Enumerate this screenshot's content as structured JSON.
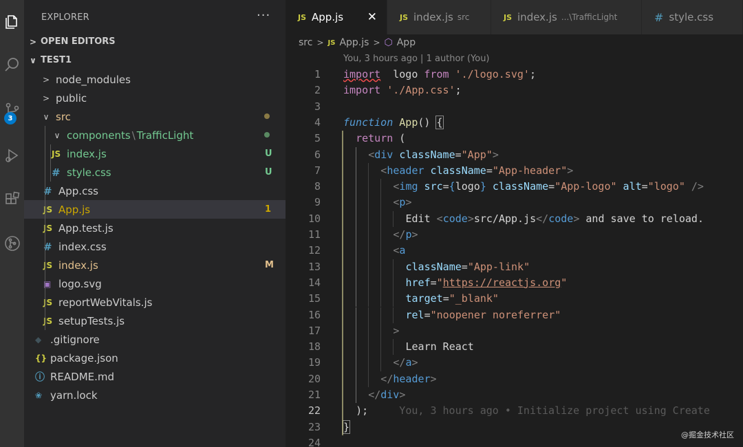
{
  "sidebar": {
    "title": "EXPLORER",
    "more": "···",
    "sections": [
      {
        "label": "OPEN EDITORS",
        "chev": ">"
      },
      {
        "label": "TEST1",
        "chev": "∨"
      }
    ],
    "badge": "3",
    "tree": [
      {
        "label": "node_modules",
        "type": "folder",
        "chev": ">",
        "depth": 1
      },
      {
        "label": "public",
        "type": "folder",
        "chev": ">",
        "depth": 1
      },
      {
        "label": "src",
        "type": "folder-open",
        "chev": "∨",
        "depth": 1,
        "status": "dot"
      },
      {
        "label": "components",
        "sub": "\\",
        "label2": "TrafficLight",
        "type": "folder-open",
        "chev": "∨",
        "depth": 2,
        "status": "dot-green"
      },
      {
        "label": "index.js",
        "type": "js",
        "icon": "JS",
        "depth": 3,
        "status": "U"
      },
      {
        "label": "style.css",
        "type": "css",
        "icon": "#",
        "depth": 3,
        "status": "U"
      },
      {
        "label": "App.css",
        "type": "css",
        "icon": "#",
        "depth": 2
      },
      {
        "label": "App.js",
        "type": "js",
        "icon": "JS",
        "depth": 2,
        "status": "1",
        "active": true
      },
      {
        "label": "App.test.js",
        "type": "js",
        "icon": "JS",
        "depth": 2
      },
      {
        "label": "index.css",
        "type": "css",
        "icon": "#",
        "depth": 2
      },
      {
        "label": "index.js",
        "type": "js",
        "icon": "JS",
        "depth": 2,
        "status": "M"
      },
      {
        "label": "logo.svg",
        "type": "svg",
        "icon": "▣",
        "depth": 2
      },
      {
        "label": "reportWebVitals.js",
        "type": "js",
        "icon": "JS",
        "depth": 2
      },
      {
        "label": "setupTests.js",
        "type": "js",
        "icon": "JS",
        "depth": 2
      },
      {
        "label": ".gitignore",
        "type": "git",
        "icon": "◆",
        "depth": 1
      },
      {
        "label": "package.json",
        "type": "json",
        "icon": "{}",
        "depth": 1
      },
      {
        "label": "README.md",
        "type": "info",
        "icon": "ⓘ",
        "depth": 1
      },
      {
        "label": "yarn.lock",
        "type": "yarn",
        "icon": "❀",
        "depth": 1
      }
    ]
  },
  "tabs": [
    {
      "label": "App.js",
      "icon": "JS",
      "desc": "",
      "active": true,
      "close": "✕"
    },
    {
      "label": "index.js",
      "icon": "JS",
      "desc": "src"
    },
    {
      "label": "index.js",
      "icon": "JS",
      "desc": "...\\TrafficLight"
    },
    {
      "label": "style.css",
      "icon": "#",
      "desc": ""
    }
  ],
  "breadcrumb": {
    "folder": "src",
    "file": "App.js",
    "file_icon": "JS",
    "symbol": "App",
    "sep": ">"
  },
  "blame": "You, 3 hours ago | 1 author (You)",
  "current_line": 22,
  "code": [
    [
      [
        "k squig",
        "import"
      ],
      [
        "",
        "  logo "
      ],
      [
        "k",
        "from"
      ],
      [
        "",
        ""
      ],
      [
        "s",
        " './logo.svg'"
      ],
      [
        "",
        ";"
      ]
    ],
    [
      [
        "k",
        "import"
      ],
      [
        "s",
        " './App.css'"
      ],
      [
        "",
        ";"
      ]
    ],
    [],
    [
      [
        "fn",
        "function"
      ],
      [
        "",
        ""
      ],
      [
        "nm",
        " App"
      ],
      [
        "",
        "() "
      ],
      [
        "brk",
        "{"
      ]
    ],
    [
      [
        "k",
        "return"
      ],
      [
        "",
        " ("
      ]
    ],
    [
      [
        "gr",
        "<"
      ],
      [
        "tg",
        "div"
      ],
      [
        "at",
        " className"
      ],
      [
        "",
        "="
      ],
      [
        "s",
        "\"App\""
      ],
      [
        "gr",
        ">"
      ]
    ],
    [
      [
        "gr",
        "<"
      ],
      [
        "tg",
        "header"
      ],
      [
        "at",
        " className"
      ],
      [
        "",
        "="
      ],
      [
        "s",
        "\"App-header\""
      ],
      [
        "gr",
        ">"
      ]
    ],
    [
      [
        "gr",
        "<"
      ],
      [
        "tg",
        "img"
      ],
      [
        "at",
        " src"
      ],
      [
        "",
        "="
      ],
      [
        "tg",
        "{"
      ],
      [
        "",
        "logo"
      ],
      [
        "tg",
        "}"
      ],
      [
        "at",
        " className"
      ],
      [
        "",
        "="
      ],
      [
        "s",
        "\"App-logo\""
      ],
      [
        "at",
        " alt"
      ],
      [
        "",
        "="
      ],
      [
        "s",
        "\"logo\""
      ],
      [
        "",
        " "
      ],
      [
        "gr",
        "/>"
      ]
    ],
    [
      [
        "gr",
        "<"
      ],
      [
        "tg",
        "p"
      ],
      [
        "gr",
        ">"
      ]
    ],
    [
      [
        "",
        "Edit "
      ],
      [
        "gr",
        "<"
      ],
      [
        "tg",
        "code"
      ],
      [
        "gr",
        ">"
      ],
      [
        "",
        "src/App.js"
      ],
      [
        "gr",
        "</"
      ],
      [
        "tg",
        "code"
      ],
      [
        "gr",
        ">"
      ],
      [
        "",
        " and save to reload."
      ]
    ],
    [
      [
        "gr",
        "</"
      ],
      [
        "tg",
        "p"
      ],
      [
        "gr",
        ">"
      ]
    ],
    [
      [
        "gr",
        "<"
      ],
      [
        "tg",
        "a"
      ]
    ],
    [
      [
        "at",
        "className"
      ],
      [
        "",
        "="
      ],
      [
        "s",
        "\"App-link\""
      ]
    ],
    [
      [
        "at",
        "href"
      ],
      [
        "",
        "="
      ],
      [
        "s",
        "\""
      ],
      [
        "s ul",
        "https://reactjs.org"
      ],
      [
        "s",
        "\""
      ]
    ],
    [
      [
        "at",
        "target"
      ],
      [
        "",
        "="
      ],
      [
        "s",
        "\"_blank\""
      ]
    ],
    [
      [
        "at",
        "rel"
      ],
      [
        "",
        "="
      ],
      [
        "s",
        "\"noopener noreferrer\""
      ]
    ],
    [
      [
        "gr",
        ">"
      ]
    ],
    [
      [
        "",
        "Learn React"
      ]
    ],
    [
      [
        "gr",
        "</"
      ],
      [
        "tg",
        "a"
      ],
      [
        "gr",
        ">"
      ]
    ],
    [
      [
        "gr",
        "</"
      ],
      [
        "tg",
        "header"
      ],
      [
        "gr",
        ">"
      ]
    ],
    [
      [
        "gr",
        "</"
      ],
      [
        "tg",
        "div"
      ],
      [
        "gr",
        ">"
      ]
    ],
    [
      [
        "",
        ");"
      ],
      [
        "ghost",
        "     You, 3 hours ago • Initialize project using Create"
      ]
    ],
    [
      [
        "brk",
        "}"
      ]
    ],
    []
  ],
  "watermark": "@掘金技术社区"
}
